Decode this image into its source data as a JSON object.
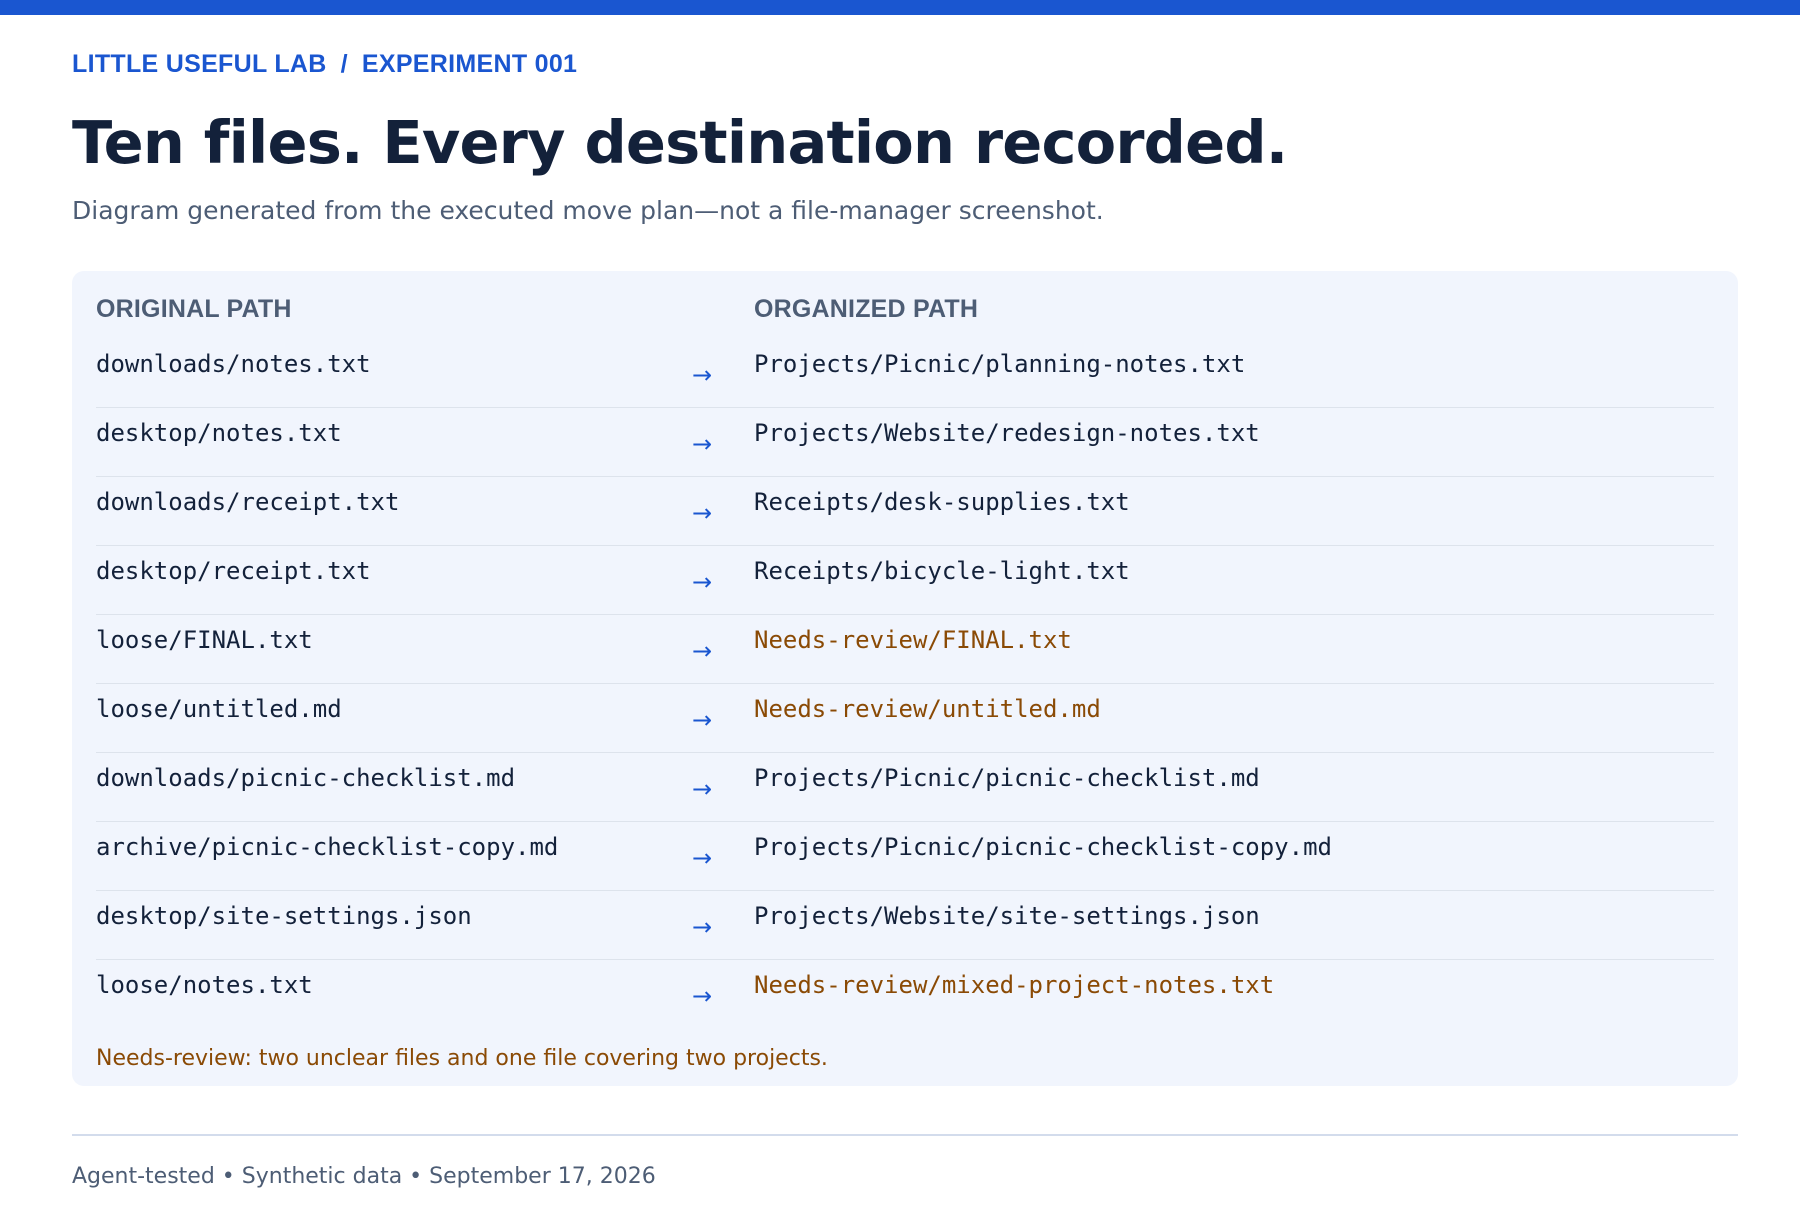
{
  "breadcrumb": {
    "lab": "LITTLE USEFUL LAB",
    "separator": "/",
    "experiment": "EXPERIMENT 001"
  },
  "header": {
    "title": "Ten files. Every destination recorded.",
    "subtitle": "Diagram generated from the executed move plan—not a file-manager screenshot."
  },
  "table": {
    "columns": {
      "original": "ORIGINAL PATH",
      "organized": "ORGANIZED PATH"
    },
    "arrow_icon": "arrow-right-icon",
    "rows": [
      {
        "from": "downloads/notes.txt",
        "arrow": "→",
        "to": "Projects/Picnic/planning-notes.txt",
        "review": false
      },
      {
        "from": "desktop/notes.txt",
        "arrow": "→",
        "to": "Projects/Website/redesign-notes.txt",
        "review": false
      },
      {
        "from": "downloads/receipt.txt",
        "arrow": "→",
        "to": "Receipts/desk-supplies.txt",
        "review": false
      },
      {
        "from": "desktop/receipt.txt",
        "arrow": "→",
        "to": "Receipts/bicycle-light.txt",
        "review": false
      },
      {
        "from": "loose/FINAL.txt",
        "arrow": "→",
        "to": "Needs-review/FINAL.txt",
        "review": true
      },
      {
        "from": "loose/untitled.md",
        "arrow": "→",
        "to": "Needs-review/untitled.md",
        "review": true
      },
      {
        "from": "downloads/picnic-checklist.md",
        "arrow": "→",
        "to": "Projects/Picnic/picnic-checklist.md",
        "review": false
      },
      {
        "from": "archive/picnic-checklist-copy.md",
        "arrow": "→",
        "to": "Projects/Picnic/picnic-checklist-copy.md",
        "review": false
      },
      {
        "from": "desktop/site-settings.json",
        "arrow": "→",
        "to": "Projects/Website/site-settings.json",
        "review": false
      },
      {
        "from": "loose/notes.txt",
        "arrow": "→",
        "to": "Needs-review/mixed-project-notes.txt",
        "review": true
      }
    ],
    "note": "Needs-review: two unclear files and one file covering two projects."
  },
  "footer": {
    "text": "Agent-tested • Synthetic data • September 17, 2026"
  },
  "colors": {
    "accent": "#1a56d0",
    "review": "#8a4a05",
    "panel": "#f1f5fd",
    "title": "#13213a",
    "muted": "#4d5d75"
  }
}
